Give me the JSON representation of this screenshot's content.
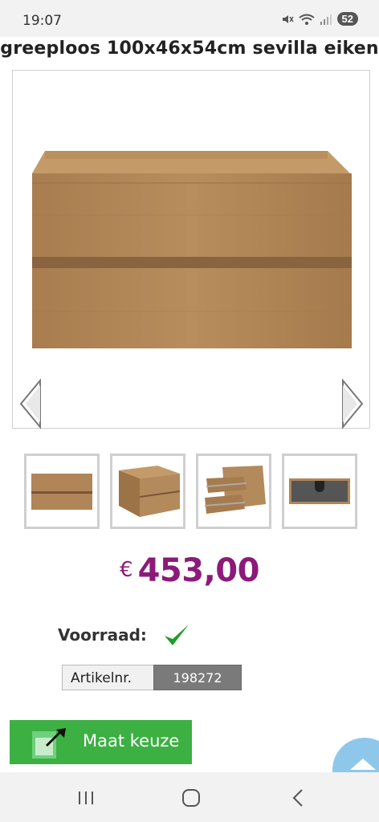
{
  "status_bar": {
    "time": "19:07",
    "battery": "52"
  },
  "product": {
    "title": "greeploos 100x46x54cm sevilla eiken",
    "price_currency": "€",
    "price_value": "453,00",
    "stock_label": "Voorraad:",
    "stock_icon": "checkmark-icon",
    "article_label": "Artikelnr.",
    "article_number": "198272",
    "size_button_label": "Maat keuze"
  },
  "gallery": {
    "previous_icon": "chevron-left-icon",
    "next_icon": "chevron-right-icon",
    "thumbnails": [
      "front-view",
      "angle-view",
      "open-drawers-view",
      "interior-view"
    ]
  },
  "navigation": {
    "recent_icon": "recent-apps-icon",
    "home_icon": "home-icon",
    "back_icon": "back-icon"
  },
  "colors": {
    "price": "#8c1a7a",
    "button": "#3cb043",
    "article_value_bg": "#7a7a7a",
    "scroll_button": "#8fc7ea"
  }
}
